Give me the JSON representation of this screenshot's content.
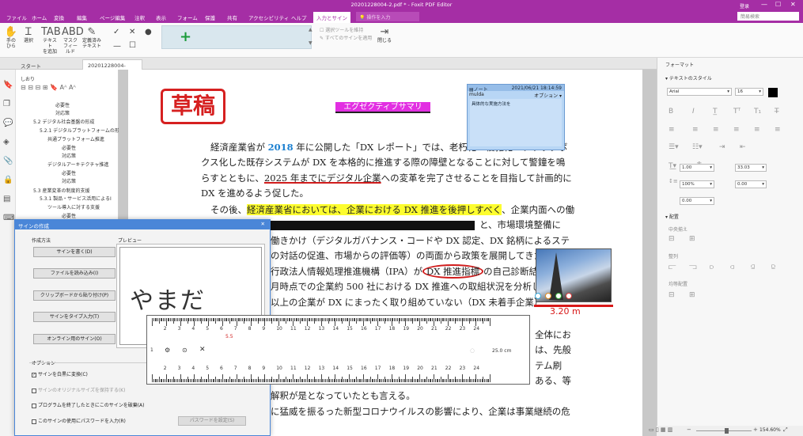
{
  "titlebar": {
    "title": "20201228004-2.pdf * - Foxit PDF Editor",
    "user": "登录"
  },
  "menu": {
    "items": [
      "ファイル",
      "ホーム",
      "変換",
      "編集",
      "ページ編集",
      "注釈",
      "表示",
      "フォーム",
      "保護",
      "共有",
      "アクセシビリティ",
      "ヘルプ",
      "入力とサイン"
    ],
    "tellme": "操作を入力",
    "search_placeholder": "簡易検索"
  },
  "ribbon": {
    "hand": "手の\nひら",
    "select": "選択",
    "text_add": "テキスト\nを追加",
    "mask_field": "マスク\nフィールド",
    "date_text": "定義済み\nテキスト",
    "keep_tool": "選択ツールを維持",
    "apply_all": "すべてのサインを適用",
    "close": "閉じる"
  },
  "tabs": {
    "start": "スタート",
    "doc": "20201228004-2.pdf *"
  },
  "bookmarks": {
    "header": "しおり",
    "items": [
      "必要性",
      "対応策",
      "5.2 デジタル社会基盤の形成",
      "5.2.1 デジタルプラットフォームの形",
      "共通プラットフォーム推進",
      "必要性",
      "対応策",
      "デジタルアーキテクチャ推進",
      "必要性",
      "対応策",
      "5.3 産業変革の制度的支援",
      "5.3.1 製品・サービス活用によるI",
      "ツール導入に対する支援",
      "必要性"
    ]
  },
  "doc": {
    "stamp": "草稿",
    "exec_summary": "エグゼクティブサマリ",
    "p1a": "経済産業省が ",
    "p1year": "2018",
    "p1b": " 年に公開した「DX レポート」では、老朽化・複雑化・ブラックボ",
    "p2": "クス化した既存システムが DX を本格的に推進する際の障壁となることに対して警鐘を鳴",
    "p3a": "らすとともに、",
    "p3ul": "2025 年までにデジタル企業",
    "p3b": "への変革を完了させることを目指して計画的に",
    "p4": "DX を進めるよう促した。",
    "p5a": "その後、",
    "p5hl": "経済産業省においては、企業における DX 推進を後押しすべく",
    "p5b": "、企業内面への働",
    "p6": "と、市場環境整備に",
    "p7": "働きかけ（デジタルガバナンス・コードや DX 認定、DX 銘柄によるステ",
    "p8": "の対話の促進、市場からの評価等）の両面から政策を展開してきた",
    "p9a": "行政法人情報処理推進機構（IPA）が",
    "p9c": "DX 推進指標",
    "p9b": "の自己診断結果を",
    "p10": "月時点での企業約 500 社における DX 推進への取組状況を分析した",
    "p11": "以上の企業が DX にまったく取り組めていない（DX 未着手企業）",
    "p12": "全体にお",
    "p13": "は、先般",
    "p14": "テム刷",
    "p15": "ある、等",
    "p16": "解釈が是となっていたとも言える。",
    "p17": "に猛威を振るった新型コロナウイルスの影響により、企業は事業継続の危"
  },
  "note": {
    "title": "ノート",
    "date": "2021/06/21 18:14:59",
    "author": "mulda",
    "options": "オプション ▾",
    "body": "具体的な実施方法を"
  },
  "measure": {
    "label": "3.20 m"
  },
  "format_panel": {
    "header": "フォーマット",
    "text_style": "テキストのスタイル",
    "font": "Arial",
    "size": "16",
    "line1": "1.00",
    "line2": "33.03",
    "scale": "100%",
    "offset": "0.00",
    "space": "0.00",
    "layout": "配置",
    "center": "中央揃え",
    "align": "整列",
    "distribute": "均等配置"
  },
  "dialog": {
    "title": "サインの作成",
    "method": "作成方法",
    "preview": "プレビュー",
    "btn_draw": "サインを書く(D)",
    "btn_file": "ファイルを読み込み(I)",
    "btn_clip": "クリップボードから貼り付け(P)",
    "btn_type": "サインをタイプ入力(T)",
    "btn_online": "オンライン用のサイン(O)",
    "options": "オプション",
    "opt1": "サインを白黒に変換(C)",
    "opt2": "サインのオリジナルサイズを保持する(K)",
    "opt3": "プログラムを終了したときにこのサインを破棄(A)",
    "opt4": "このサインの使用にパスワードを入力(R)",
    "pw_button": "パスワードを設定(S)",
    "signature": "やまだ"
  },
  "ruler": {
    "numbers": [
      "1",
      "2",
      "3",
      "4",
      "5",
      "6",
      "7",
      "8",
      "9",
      "10",
      "11",
      "12",
      "13",
      "14",
      "15",
      "16",
      "17",
      "18",
      "19",
      "20",
      "21",
      "22",
      "23",
      "24"
    ],
    "length": "25.0 cm",
    "red_mark": "5.5"
  },
  "status": {
    "zoom": "154.60%"
  }
}
